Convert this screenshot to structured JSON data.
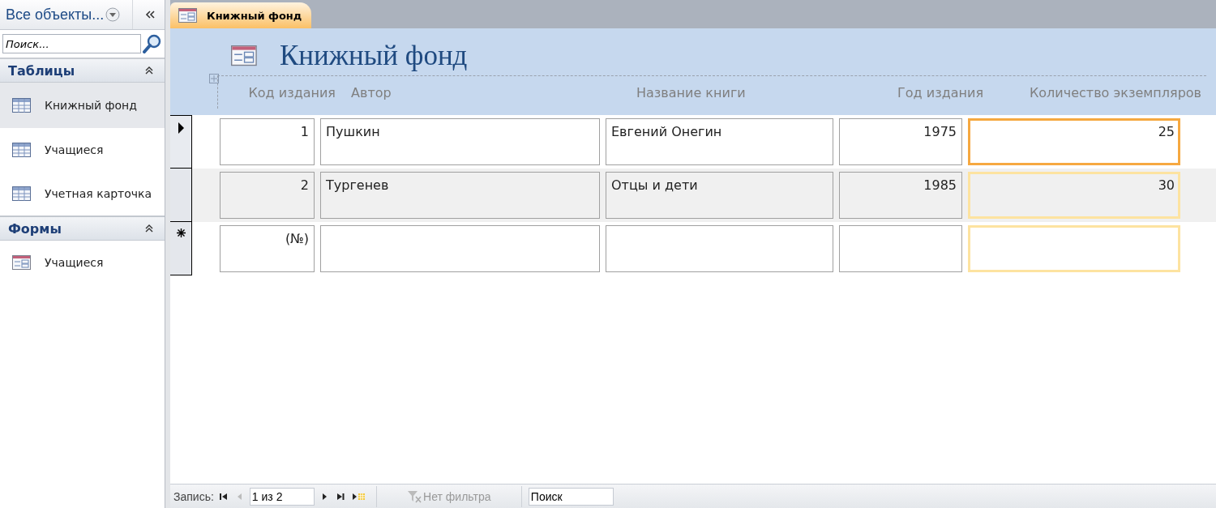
{
  "nav": {
    "title": "Все объекты...",
    "search": {
      "placeholder": "Поиск..."
    },
    "groups": [
      {
        "title": "Таблицы",
        "expanded": true,
        "items": [
          {
            "label": "Книжный фонд",
            "kind": "table",
            "selected": true
          },
          {
            "label": "Учащиеся",
            "kind": "table",
            "selected": false
          },
          {
            "label": "Учетная карточка",
            "kind": "table",
            "selected": false
          }
        ]
      },
      {
        "title": "Формы",
        "expanded": true,
        "items": [
          {
            "label": "Учащиеся",
            "kind": "form",
            "selected": false
          }
        ]
      }
    ]
  },
  "tabs": [
    {
      "label": "Книжный фонд",
      "selected": true
    }
  ],
  "form": {
    "title": "Книжный фонд",
    "columns": [
      {
        "label": "Код издания",
        "selected": false
      },
      {
        "label": "Автор",
        "selected": false
      },
      {
        "label": "Название книги",
        "selected": false
      },
      {
        "label": "Год издания",
        "selected": false
      },
      {
        "label": "Количество экземпляров",
        "selected": true
      }
    ],
    "rows": [
      {
        "kind": "record",
        "selected": true,
        "cells": [
          "1",
          "Пушкин",
          "Евгений Онегин",
          "1975",
          "25"
        ]
      },
      {
        "kind": "record",
        "selected": false,
        "cells": [
          "2",
          "Тургенев",
          "Отцы и дети",
          "1985",
          "30"
        ]
      },
      {
        "kind": "new",
        "selected": false,
        "cells": [
          "(№)",
          "",
          "",
          "",
          ""
        ]
      }
    ]
  },
  "status_bar": {
    "label": "Запись:",
    "position": "1 из 2",
    "filter": "Нет фильтра",
    "search": {
      "placeholder": "Поиск"
    }
  }
}
